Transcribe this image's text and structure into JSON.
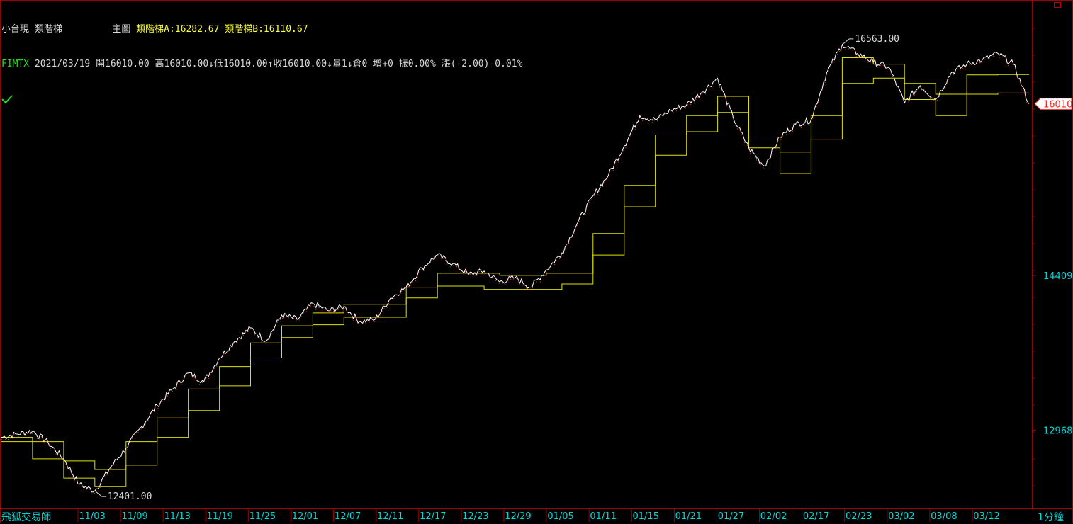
{
  "header": {
    "line1": {
      "instrument": "小台現",
      "indicator": "類階梯",
      "panel": "主圖",
      "ind_a": "類階梯A:16282.67",
      "ind_b": "類階梯B:16110.67"
    },
    "line2": {
      "symbol": "FIMTX",
      "date": "2021/03/19",
      "open": "開16010.00",
      "high": "高16010.00",
      "low_arrow": "↓",
      "low": "低16010.00",
      "close_arrow": "↑",
      "close": "收16010.00",
      "vol_arrow": "↓",
      "volume": "量1",
      "oi_arrow": "↓",
      "open_interest": "倉0",
      "oi_change": "增+0",
      "amplitude": "振0.00%",
      "change": "漲(-2.00)-0.01%"
    }
  },
  "footer": {
    "brand": "飛狐交易師",
    "timeframe": "1分鐘"
  },
  "colors": {
    "background": "#000000",
    "border": "#a00000",
    "price": "#ffffff",
    "price_alt": "#ff3030",
    "ladder_a": "#e0e000",
    "ladder_b": "#e0e000",
    "axis_text": "#00d8d8",
    "header_yellow": "#ffff40",
    "symbol_green": "#27d827",
    "last_price_tag": "#ff2020"
  },
  "icons": {
    "check": "checkmark-icon",
    "corner": "restore-window-icon"
  },
  "chart_data": {
    "type": "line",
    "x_tick_labels": [
      "11/03",
      "11/09",
      "11/13",
      "11/19",
      "11/25",
      "12/01",
      "12/07",
      "12/11",
      "12/17",
      "12/23",
      "12/29",
      "01/05",
      "01/11",
      "01/15",
      "01/21",
      "01/27",
      "02/02",
      "02/17",
      "02/23",
      "03/02",
      "03/08",
      "03/12"
    ],
    "y_tick_labels": [
      14409,
      12968
    ],
    "ylim": [
      12250,
      16780
    ],
    "annotations": {
      "max_label": "16563.00",
      "min_label": "12401.00",
      "last_price": "16010"
    },
    "series": [
      {
        "key": "price",
        "values": [
          12900,
          12930,
          12960,
          12850,
          12700,
          12460,
          12401,
          12620,
          12800,
          13000,
          13200,
          13350,
          13500,
          13420,
          13640,
          13800,
          13920,
          13800,
          14040,
          14000,
          14150,
          14080,
          14120,
          13980,
          14000,
          14200,
          14300,
          14480,
          14600,
          14520,
          14420,
          14450,
          14350,
          14390,
          14300,
          14460,
          14620,
          14900,
          15150,
          15350,
          15620,
          15900,
          15860,
          15950,
          16000,
          16120,
          16250,
          15880,
          15600,
          15430,
          15700,
          15820,
          15860,
          16300,
          16563,
          16480,
          16400,
          16350,
          16020,
          16180,
          16050,
          16300,
          16380,
          16420,
          16480,
          16380,
          16010
        ]
      },
      {
        "key": "ladder_a",
        "values": [
          12900,
          12900,
          12860,
          12860,
          12680,
          12680,
          12600,
          12600,
          12860,
          12860,
          13080,
          13080,
          13350,
          13350,
          13560,
          13560,
          13780,
          13780,
          13940,
          13940,
          14060,
          14060,
          14140,
          14140,
          14140,
          14140,
          14300,
          14300,
          14430,
          14430,
          14430,
          14430,
          14410,
          14410,
          14410,
          14430,
          14430,
          14430,
          14800,
          14800,
          15250,
          15250,
          15720,
          15720,
          15900,
          15900,
          16080,
          16080,
          15700,
          15700,
          15560,
          15560,
          15900,
          15900,
          16440,
          16440,
          16380,
          16380,
          16200,
          16200,
          16100,
          16100,
          16280,
          16280,
          16282.67,
          16282.67,
          16282.67
        ]
      },
      {
        "key": "ladder_b",
        "values": [
          12860,
          12860,
          12700,
          12700,
          12520,
          12520,
          12440,
          12440,
          12640,
          12640,
          12900,
          12900,
          13150,
          13150,
          13380,
          13380,
          13640,
          13640,
          13830,
          13830,
          13950,
          13950,
          14020,
          14020,
          14020,
          14020,
          14200,
          14200,
          14310,
          14310,
          14310,
          14280,
          14280,
          14280,
          14280,
          14280,
          14330,
          14330,
          14600,
          14600,
          15050,
          15050,
          15530,
          15530,
          15750,
          15750,
          15930,
          15930,
          15600,
          15600,
          15360,
          15360,
          15680,
          15680,
          16200,
          16200,
          16250,
          16250,
          16050,
          16050,
          15900,
          15900,
          16100,
          16100,
          16110.67,
          16110.67,
          16110.67
        ]
      }
    ]
  }
}
